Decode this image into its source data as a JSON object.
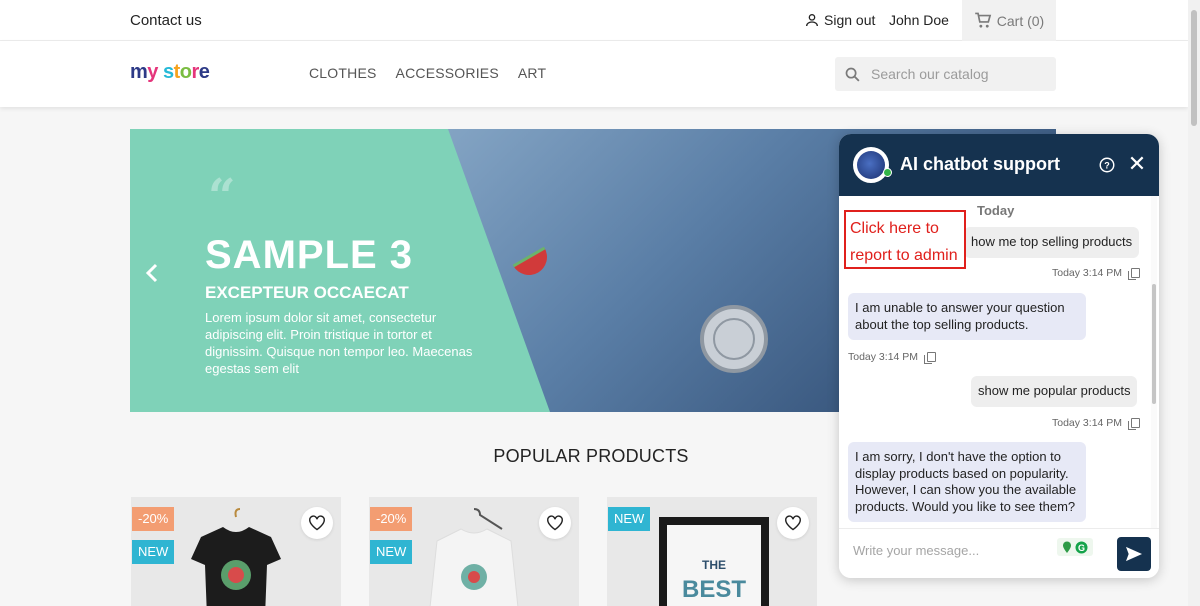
{
  "topbar": {
    "contact": "Contact us",
    "sign_out": "Sign out",
    "user_name": "John Doe",
    "cart": "Cart (0)"
  },
  "header": {
    "logo": "my store",
    "nav": [
      "CLOTHES",
      "ACCESSORIES",
      "ART"
    ],
    "search_placeholder": "Search our catalog"
  },
  "banner": {
    "title": "SAMPLE 3",
    "subtitle": "EXCEPTEUR OCCAECAT",
    "text": "Lorem ipsum dolor sit amet, consectetur adipiscing elit. Proin tristique in tortor et dignissim. Quisque non tempor leo. Maecenas egestas sem elit",
    "bg_color": "#7fd2b8"
  },
  "popular": {
    "heading": "POPULAR PRODUCTS",
    "products": [
      {
        "discount": "-20%",
        "flag": "NEW"
      },
      {
        "discount": "-20%",
        "flag": "NEW"
      },
      {
        "discount": "",
        "flag": "NEW"
      },
      {
        "discount": "",
        "flag": ""
      }
    ]
  },
  "chat": {
    "title": "AI chatbot support",
    "day_label": "Today",
    "messages": [
      {
        "from": "user",
        "text": "how me top selling products",
        "time": "Today 3:14 PM"
      },
      {
        "from": "bot",
        "text": "I am unable to answer your question about the top selling products.",
        "time": "Today 3:14 PM"
      },
      {
        "from": "user",
        "text": "show me popular products",
        "time": "Today 3:14 PM"
      },
      {
        "from": "bot",
        "text": "I am sorry, I don't have the option to display products based on popularity. However, I can show you the available products. Would you like to see them?"
      }
    ],
    "input_placeholder": "Write your message..."
  },
  "annotation": {
    "text": "Click here to report to admin",
    "color": "#e0201c"
  },
  "colors": {
    "chat_header": "#15324f",
    "accent": "#2fb5d2",
    "discount": "#f39d72"
  }
}
